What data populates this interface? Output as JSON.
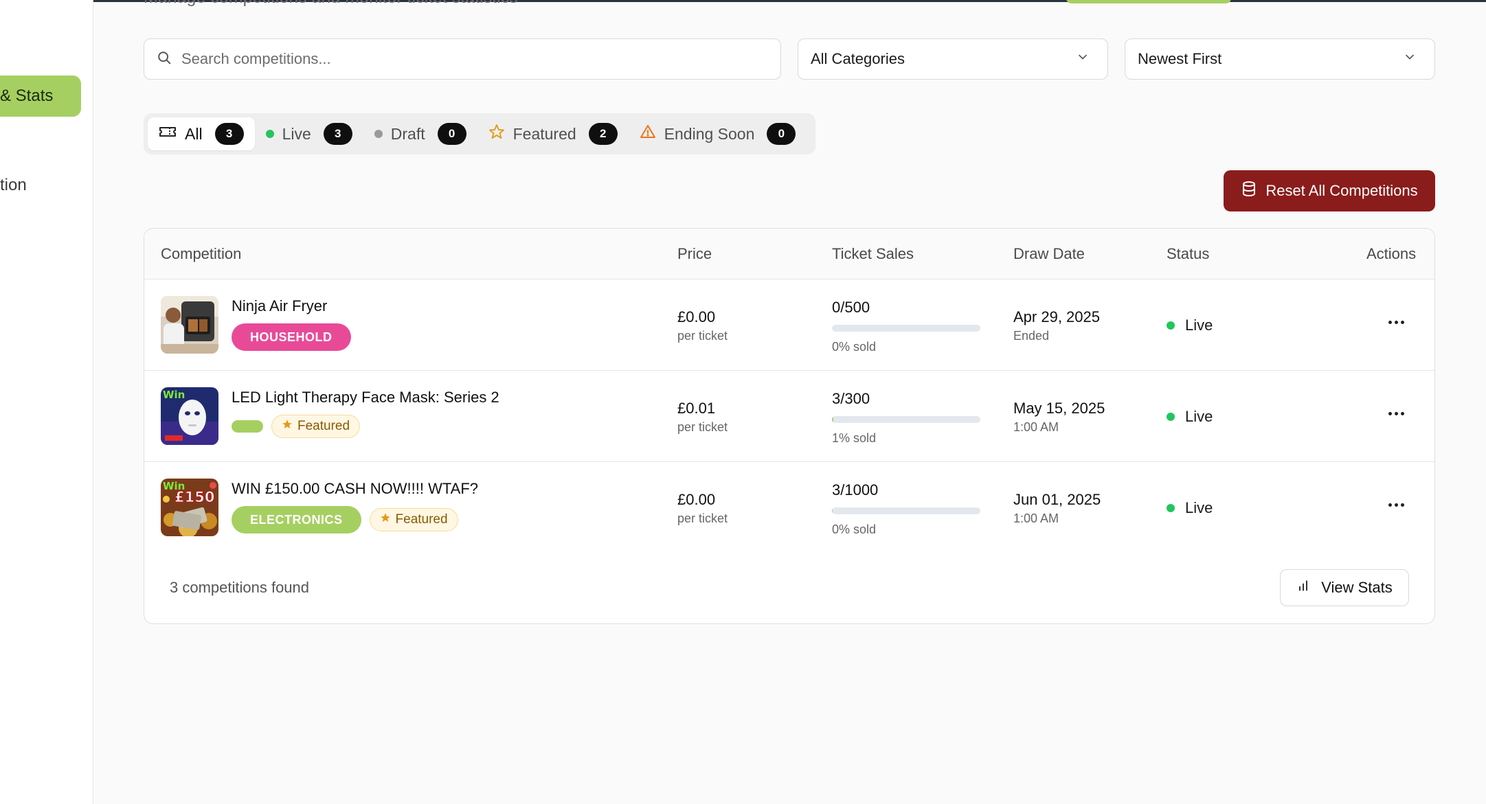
{
  "header": {
    "subtitle": "Manage competitions and monitor ticket statistics"
  },
  "sidebar": {
    "active_item": "& Stats",
    "item": "tion"
  },
  "search": {
    "placeholder": "Search competitions..."
  },
  "filters": {
    "category": "All Categories",
    "sort": "Newest First"
  },
  "tabs": [
    {
      "label": "All",
      "count": "3"
    },
    {
      "label": "Live",
      "count": "3"
    },
    {
      "label": "Draft",
      "count": "0"
    },
    {
      "label": "Featured",
      "count": "2"
    },
    {
      "label": "Ending Soon",
      "count": "0"
    }
  ],
  "reset_button": "Reset All Competitions",
  "table": {
    "headers": [
      "Competition",
      "Price",
      "Ticket Sales",
      "Draw Date",
      "Status",
      "Actions"
    ],
    "rows": [
      {
        "name": "Ninja Air Fryer",
        "category": "HOUSEHOLD",
        "featured": "",
        "price": "£0.00",
        "price_sub": "per ticket",
        "sales": "0/500",
        "sold_fraction": 0,
        "sold_text": "0% sold",
        "draw_date": "Apr 29, 2025",
        "draw_sub": "Ended",
        "status": "Live"
      },
      {
        "name": "LED Light Therapy Face Mask: Series 2",
        "category": "",
        "featured": "Featured",
        "price": "£0.01",
        "price_sub": "per ticket",
        "sales": "3/300",
        "sold_fraction": 0.01,
        "sold_text": "1% sold",
        "draw_date": "May 15, 2025",
        "draw_sub": "1:00 AM",
        "status": "Live",
        "thumb_label": "Win"
      },
      {
        "name": "WIN £150.00 CASH NOW!!!! WTAF?",
        "category": "ELECTRONICS",
        "featured": "Featured",
        "price": "£0.00",
        "price_sub": "per ticket",
        "sales": "3/1000",
        "sold_fraction": 0.003,
        "sold_text": "0% sold",
        "draw_date": "Jun 01, 2025",
        "draw_sub": "1:00 AM",
        "status": "Live",
        "thumb_label": "Win",
        "thumb_amount": "£150"
      }
    ]
  },
  "footer": {
    "count_text": "3 competitions found",
    "view_stats": "View Stats"
  },
  "colors": {
    "accent_green": "#a6cf61",
    "danger_red": "#8a1c1c",
    "household_pink": "#e84a98",
    "live_green": "#22c55e"
  }
}
